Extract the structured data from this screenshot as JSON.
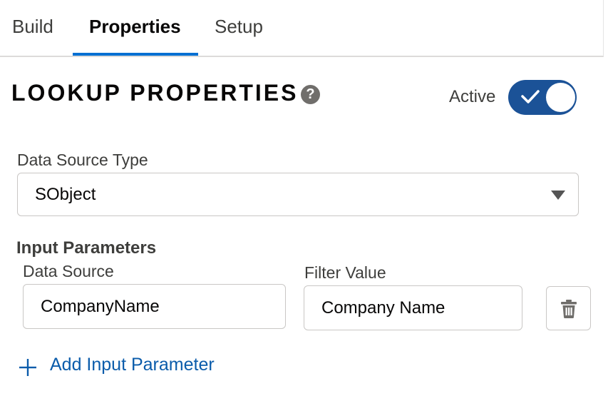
{
  "tabs": [
    {
      "label": "Build",
      "active": false
    },
    {
      "label": "Properties",
      "active": true
    },
    {
      "label": "Setup",
      "active": false
    }
  ],
  "header": {
    "title": "LOOKUP PROPERTIES",
    "help_icon": "question-circle-icon",
    "active_label": "Active",
    "active_on": true
  },
  "data_source_type": {
    "label": "Data Source Type",
    "value": "SObject"
  },
  "input_parameters": {
    "heading": "Input Parameters",
    "data_source_label": "Data Source",
    "filter_value_label": "Filter Value",
    "rows": [
      {
        "data_source": "CompanyName",
        "filter_value": "Company Name"
      }
    ],
    "add_label": "Add Input Parameter"
  },
  "colors": {
    "accent": "#0070d2",
    "toggle_on": "#1b5297",
    "link": "#0b5cab"
  }
}
